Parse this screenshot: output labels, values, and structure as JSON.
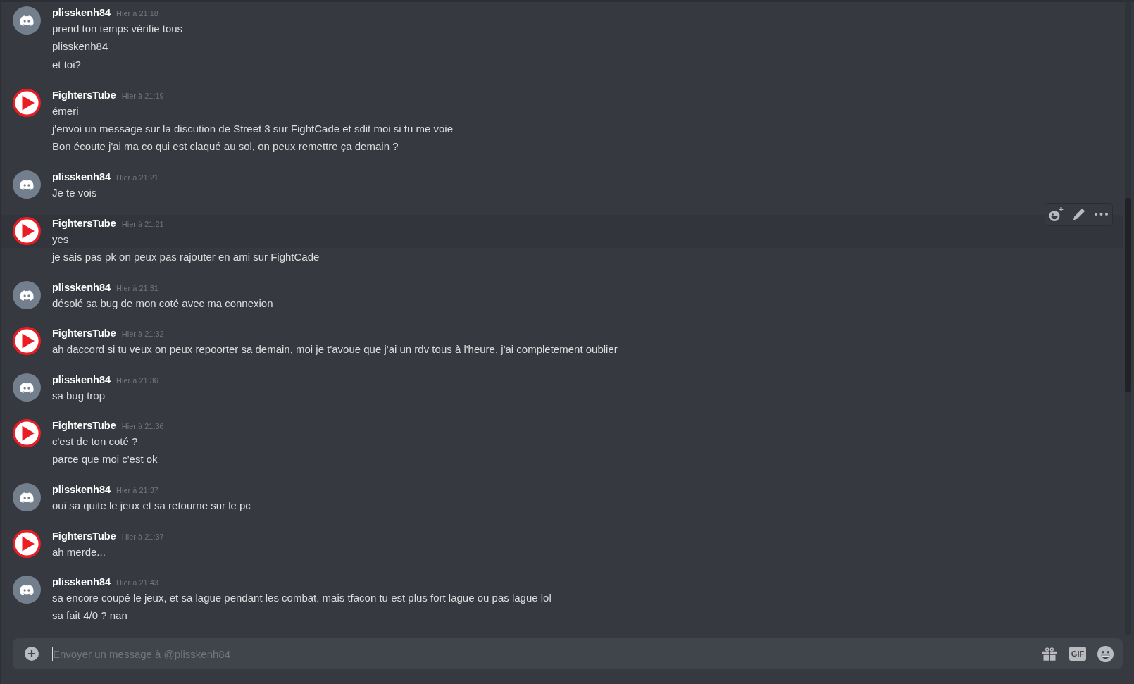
{
  "message_groups": [
    {
      "author": "plisskenh84",
      "avatar": {
        "kind": "default"
      },
      "timestamp": "Hier à 21:18",
      "messages": [
        {
          "text": "prend ton temps vérifie tous",
          "hovered": false
        },
        {
          "text": "plisskenh84",
          "hovered": false
        },
        {
          "text": "et toi?",
          "hovered": false
        }
      ]
    },
    {
      "author": "FightersTube",
      "avatar": {
        "kind": "play"
      },
      "timestamp": "Hier à 21:19",
      "messages": [
        {
          "text": "émeri",
          "hovered": false
        },
        {
          "text": "j'envoi un message sur la discution de Street 3 sur FightCade et sdit moi si tu me voie",
          "hovered": false
        },
        {
          "text": "Bon écoute j'ai ma co qui est claqué au sol, on peux remettre ça demain ?",
          "hovered": false
        }
      ]
    },
    {
      "author": "plisskenh84",
      "avatar": {
        "kind": "default"
      },
      "timestamp": "Hier à 21:21",
      "messages": [
        {
          "text": "Je te vois",
          "hovered": false
        }
      ]
    },
    {
      "author": "FightersTube",
      "avatar": {
        "kind": "play"
      },
      "timestamp": "Hier à 21:21",
      "messages": [
        {
          "text": "yes",
          "hovered": true
        },
        {
          "text": "je sais pas pk on peux pas rajouter en ami sur FightCade",
          "hovered": false
        }
      ]
    },
    {
      "author": "plisskenh84",
      "avatar": {
        "kind": "default"
      },
      "timestamp": "Hier à 21:31",
      "messages": [
        {
          "text": "désolé sa bug de mon coté avec ma connexion",
          "hovered": false
        }
      ]
    },
    {
      "author": "FightersTube",
      "avatar": {
        "kind": "play"
      },
      "timestamp": "Hier à 21:32",
      "messages": [
        {
          "text": "ah daccord si tu veux on peux repoorter sa demain, moi je t'avoue que j'ai un rdv tous à l'heure, j'ai completement oublier",
          "hovered": false
        }
      ]
    },
    {
      "author": "plisskenh84",
      "avatar": {
        "kind": "default"
      },
      "timestamp": "Hier à 21:36",
      "messages": [
        {
          "text": "sa bug trop",
          "hovered": false
        }
      ]
    },
    {
      "author": "FightersTube",
      "avatar": {
        "kind": "play"
      },
      "timestamp": "Hier à 21:36",
      "messages": [
        {
          "text": "c'est de ton coté ?",
          "hovered": false
        },
        {
          "text": "parce que moi c'est ok",
          "hovered": false
        }
      ]
    },
    {
      "author": "plisskenh84",
      "avatar": {
        "kind": "default"
      },
      "timestamp": "Hier à 21:37",
      "messages": [
        {
          "text": "oui sa quite le jeux et sa retourne sur le pc",
          "hovered": false
        }
      ]
    },
    {
      "author": "FightersTube",
      "avatar": {
        "kind": "play"
      },
      "timestamp": "Hier à 21:37",
      "messages": [
        {
          "text": "ah merde...",
          "hovered": false
        }
      ]
    },
    {
      "author": "plisskenh84",
      "avatar": {
        "kind": "default"
      },
      "timestamp": "Hier à 21:43",
      "messages": [
        {
          "text": "sa encore coupé le jeux, et sa lague pendant les combat, mais tfacon tu est plus fort lague ou pas lague lol",
          "hovered": false
        },
        {
          "text": "sa fait 4/0 ? nan",
          "hovered": false
        }
      ]
    }
  ],
  "composer": {
    "placeholder": "Envoyer un message à @plisskenh84",
    "focused": true,
    "gif_label": "GIF"
  }
}
